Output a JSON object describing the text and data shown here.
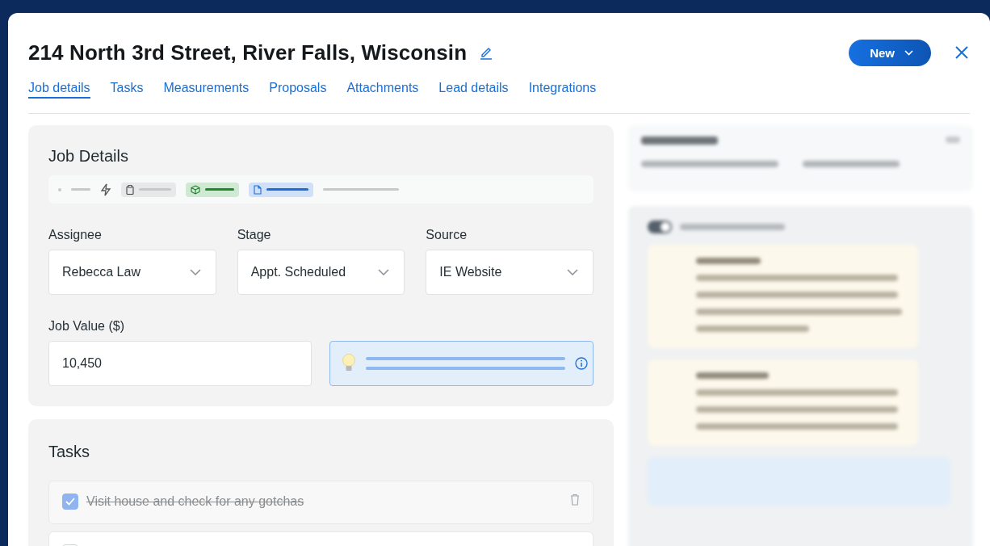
{
  "title": "214 North 3rd Street, River Falls, Wisconsin",
  "new_button": "New",
  "tabs": [
    {
      "label": "Job details",
      "selected": true
    },
    {
      "label": "Tasks",
      "selected": false
    },
    {
      "label": "Measurements",
      "selected": false
    },
    {
      "label": "Proposals",
      "selected": false
    },
    {
      "label": "Attachments",
      "selected": false
    },
    {
      "label": "Lead details",
      "selected": false
    },
    {
      "label": "Integrations",
      "selected": false
    }
  ],
  "job_details": {
    "heading": "Job Details",
    "fields": [
      {
        "label": "Assignee",
        "value": "Rebecca Law"
      },
      {
        "label": "Stage",
        "value": "Appt. Scheduled"
      },
      {
        "label": "Source",
        "value": "IE Website"
      }
    ],
    "job_value": {
      "label": "Job Value ($)",
      "value": "10,450"
    }
  },
  "activity_toggle": {
    "on": true
  },
  "tasks": {
    "heading": "Tasks",
    "items": [
      {
        "text": "Visit house and check for any gotchas",
        "checked": true
      },
      {
        "checked": false
      }
    ]
  }
}
